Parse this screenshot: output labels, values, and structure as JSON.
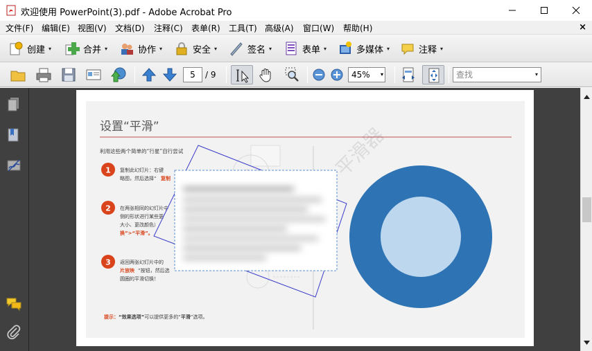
{
  "window": {
    "title": "欢迎使用 PowerPoint(3).pdf - Adobe Acrobat Pro",
    "minimize": "—",
    "maximize": "☐",
    "close": "✕"
  },
  "menubar": {
    "items": [
      "文件(F)",
      "编辑(E)",
      "视图(V)",
      "文档(D)",
      "注释(C)",
      "表单(R)",
      "工具(T)",
      "高级(A)",
      "窗口(W)",
      "帮助(H)"
    ],
    "close": "×"
  },
  "toolbar_tasks": {
    "items": [
      {
        "label": "创建",
        "icon": "create-icon"
      },
      {
        "label": "合并",
        "icon": "combine-icon"
      },
      {
        "label": "协作",
        "icon": "collaborate-icon"
      },
      {
        "label": "安全",
        "icon": "lock-icon"
      },
      {
        "label": "签名",
        "icon": "pen-icon"
      },
      {
        "label": "表单",
        "icon": "forms-icon"
      },
      {
        "label": "多媒体",
        "icon": "multimedia-icon"
      },
      {
        "label": "注释",
        "icon": "comment-icon"
      }
    ],
    "dropdown": "▾"
  },
  "toolbar_nav": {
    "page_current": "5",
    "page_total": "/ 9",
    "zoom": "45%",
    "find_placeholder": "查找",
    "dropdown": "▾"
  },
  "slide": {
    "title": "设置“平滑”",
    "intro": "利用这些两个简单的“行星”自行尝试",
    "steps": [
      {
        "number": "1",
        "line1": "复制此幻灯片：右键",
        "line2": "略图，然后选择“",
        "highlight2": "复制"
      },
      {
        "number": "2",
        "line1": "在两张相同的幻灯片中",
        "line2": "侧的形状进行某些更",
        "line3": "大小、更改颜色）",
        "highlight4": "换”>“平滑”。"
      },
      {
        "number": "3",
        "line1": "返回两张幻灯片中的",
        "highlight2": "片放映",
        "line2": "”按钮，然后选",
        "line3": "圆圈的平滑切换！"
      }
    ],
    "tip_label": "提示：",
    "tip_q1": "“效果选项”",
    "tip_mid": "可以提供更多的“",
    "tip_q2": "平滑",
    "tip_end": "”选项。",
    "watermark": "平滑器",
    "colors": {
      "ring_outer": "#2e74b5",
      "ring_inner": "#bdd7ee",
      "accent_red": "#d9441c",
      "title_rule": "#c0504d"
    }
  }
}
